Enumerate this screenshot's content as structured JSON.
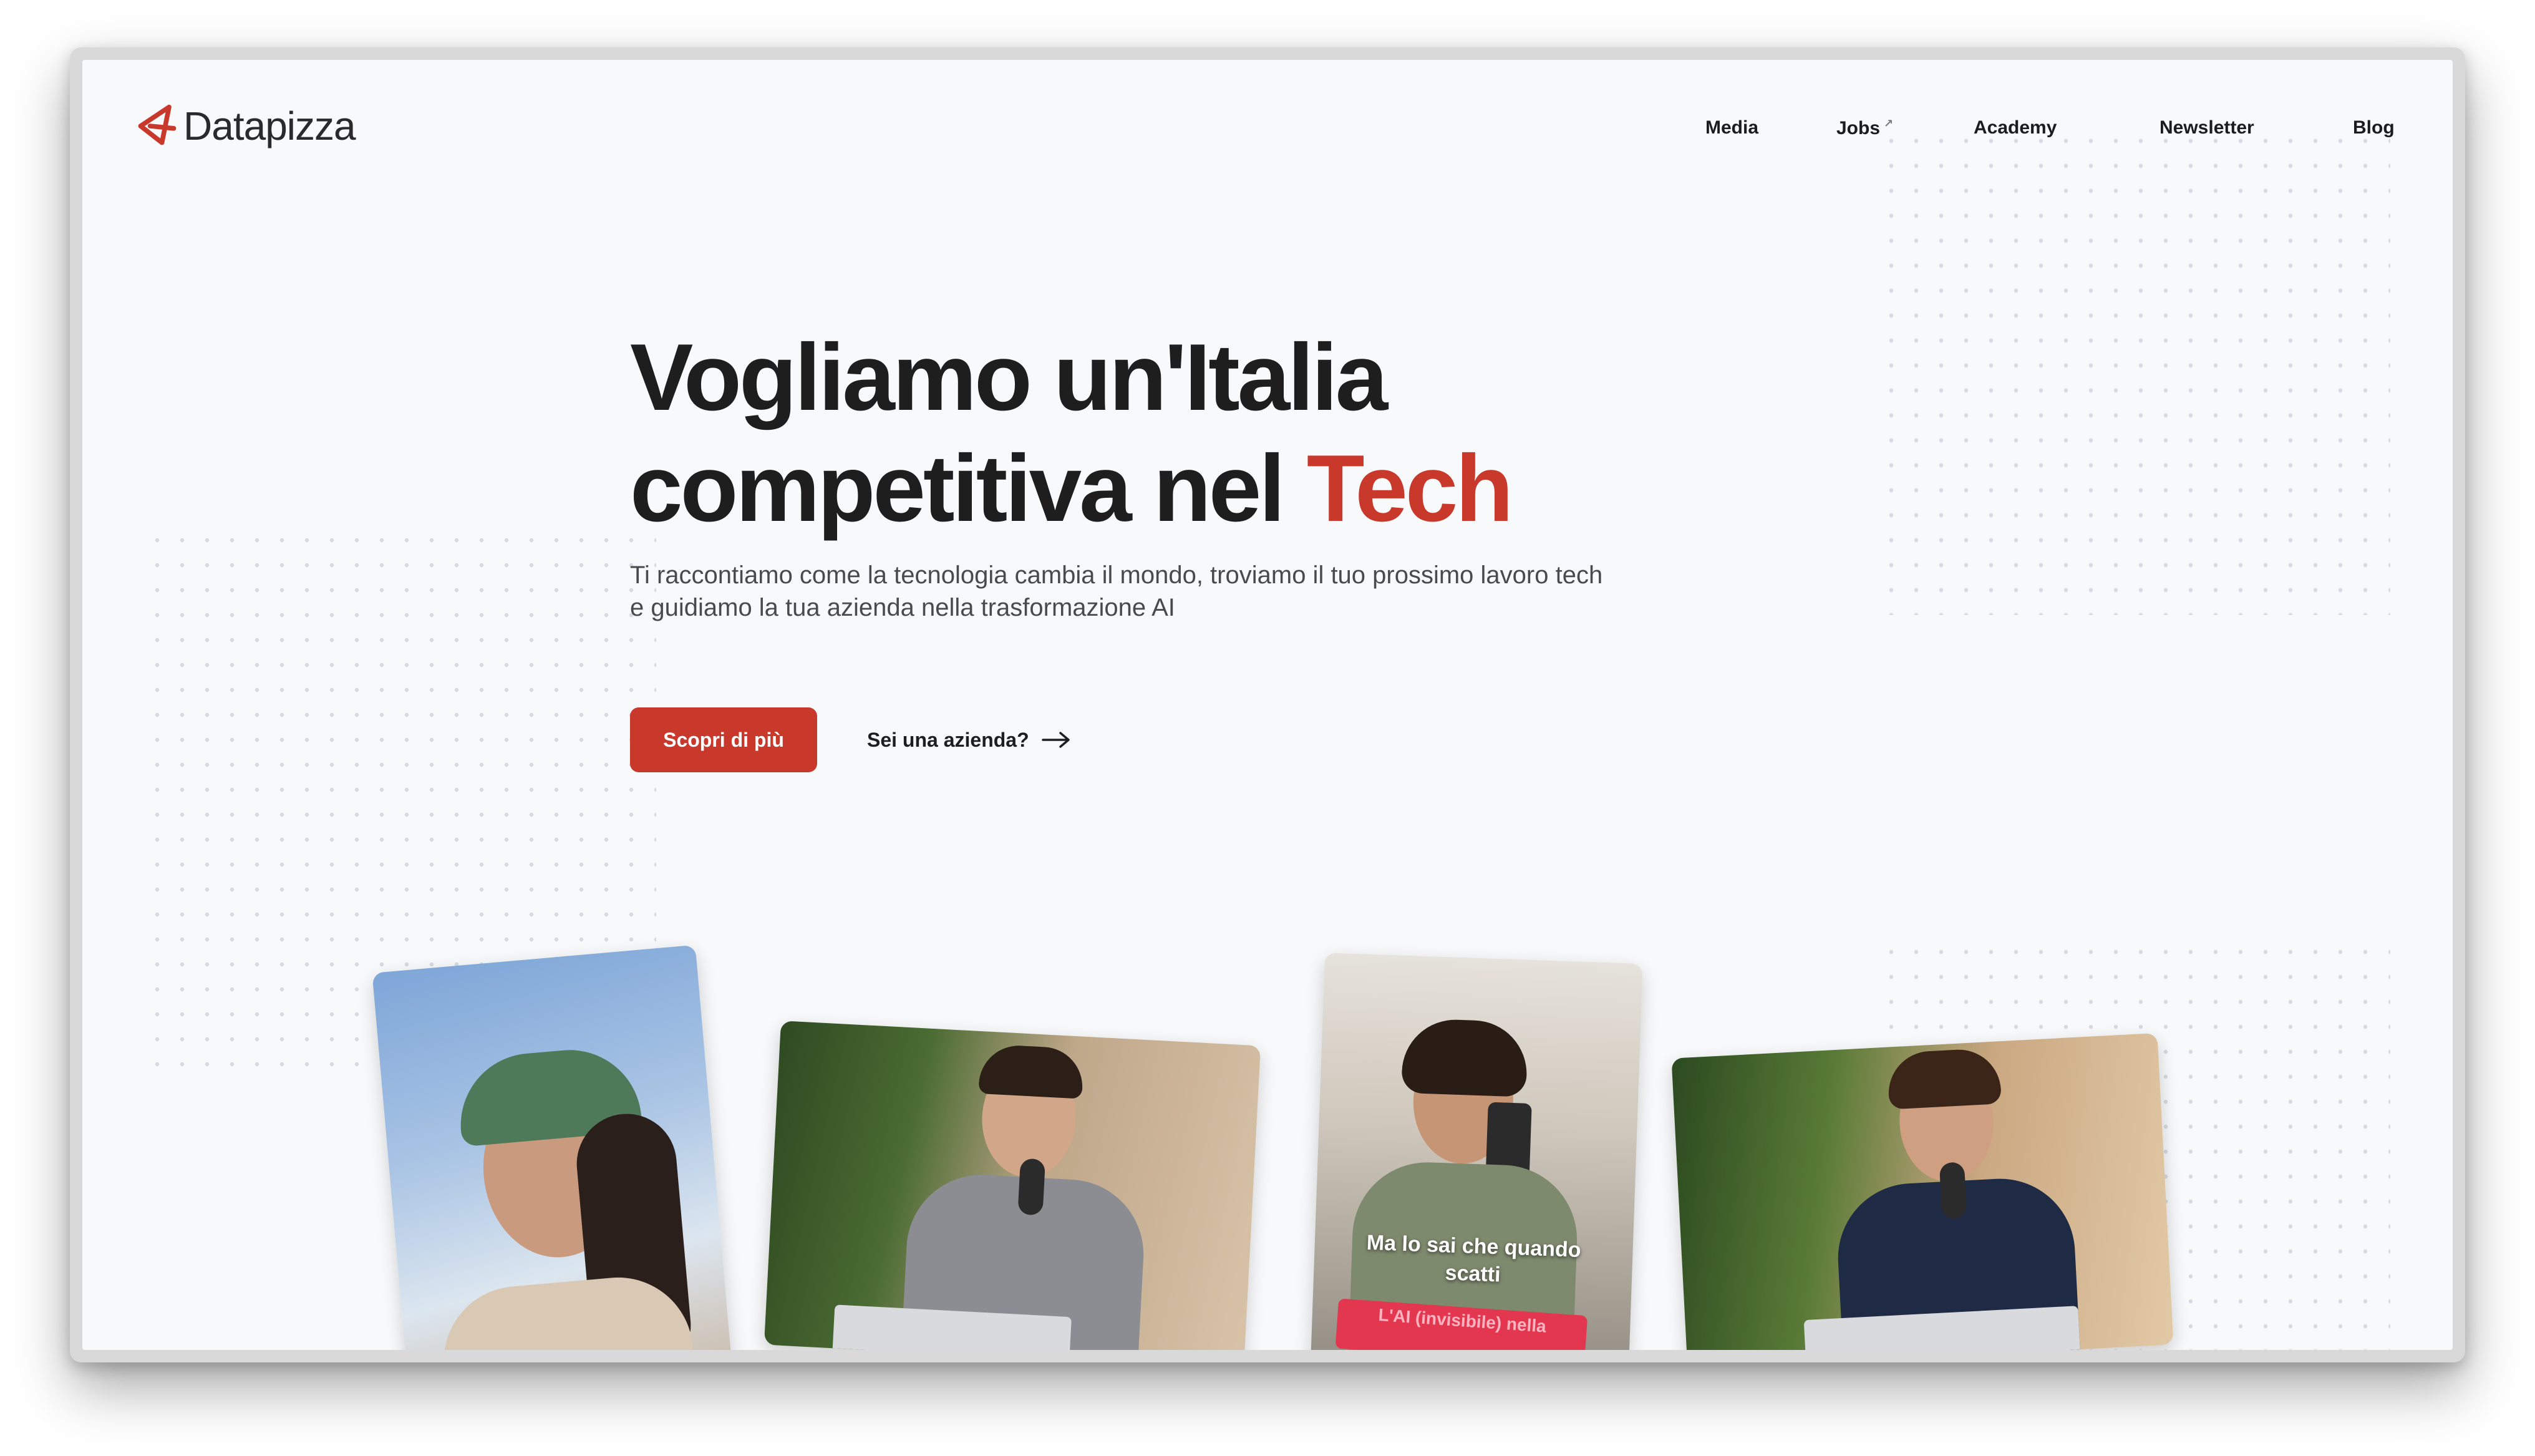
{
  "brand": {
    "name": "Datapizza",
    "accent_color": "#c8392c"
  },
  "nav": {
    "items": [
      {
        "label": "Media"
      },
      {
        "label": "Jobs",
        "external_marker": "↗"
      },
      {
        "label": "Academy"
      },
      {
        "label": "Newsletter"
      },
      {
        "label": "Blog"
      }
    ]
  },
  "hero": {
    "headline_line1": "Vogliamo un'Italia",
    "headline_line2_prefix": "competitiva nel ",
    "headline_accent": "Tech",
    "subtitle": "Ti raccontiamo come la tecnologia cambia il mondo, troviamo il tuo prossimo lavoro tech e guidiamo la tua azienda nella trasformazione AI",
    "primary_cta": "Scopri di più",
    "secondary_cta": "Sei una azienda?"
  },
  "video_cards": [
    {
      "caption": ""
    },
    {
      "caption": ""
    },
    {
      "caption": "Ma lo sai che quando scatti",
      "sticker": "L'AI (invisibile) nella"
    },
    {
      "caption": ""
    }
  ],
  "icons": {
    "logo": "datapizza-logo-icon",
    "arrow": "arrow-right-icon"
  }
}
